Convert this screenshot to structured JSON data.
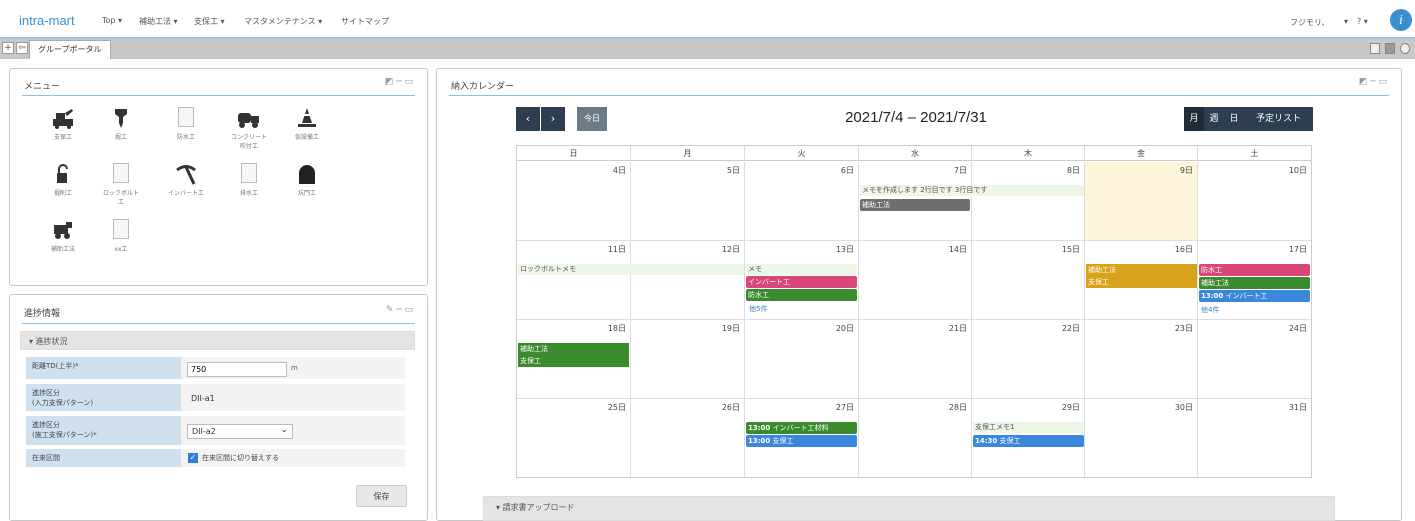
{
  "colors": {
    "accent": "#3a8fd0",
    "calendar_dark": "#2c3e50",
    "ev_green": "#3c8a2e",
    "ev_pink": "#d9467a",
    "ev_blue": "#3a87dc",
    "ev_gray": "#6f6f6f",
    "ev_gold": "#d9a21b",
    "today_bg": "#fcf5da",
    "line": "#8bbfe6"
  },
  "header": {
    "brand": "intra-mart",
    "nav": [
      "Top ▾",
      "補助工法 ▾",
      "支保工 ▾",
      "マスタメンテナンス ▾",
      "サイトマップ"
    ],
    "user": "フジモリ、",
    "user_caret": "▾",
    "help": "? ▾",
    "im_icon": "i"
  },
  "tabbar": {
    "add": "+",
    "toggle": "⇦",
    "tab": "グループポータル"
  },
  "menu": {
    "title": "メニュー",
    "tools": "◩ ─ ▭",
    "items": [
      {
        "label": "支保工",
        "icon": "excavator-icon"
      },
      {
        "label": "掘工",
        "icon": "drill-bit-icon"
      },
      {
        "label": "防水工",
        "icon": "document-icon"
      },
      {
        "label": "コンクリート\n吹付工",
        "icon": "concrete-truck-icon"
      },
      {
        "label": "仮設備工",
        "icon": "cone-icon"
      },
      {
        "label": "掘削工",
        "icon": "lock-icon"
      },
      {
        "label": "ロックボルト\n工",
        "icon": "document-icon"
      },
      {
        "label": "インバート工",
        "icon": "pickaxe-icon"
      },
      {
        "label": "排水工",
        "icon": "document-icon"
      },
      {
        "label": "坑門工",
        "icon": "tunnel-icon"
      },
      {
        "label": "補助工法",
        "icon": "machine-icon"
      },
      {
        "label": "xx工",
        "icon": "document-icon"
      }
    ]
  },
  "progress": {
    "title": "進捗情報",
    "tools": "✎ ─ ▭",
    "section": "▾ 進捗状況",
    "rows": [
      {
        "label": "距離TD(上半)*",
        "value": "750",
        "unit": "m"
      },
      {
        "label": "進捗区分\n(入力支保パターン)",
        "value": "DII-a1"
      },
      {
        "label": "進捗区分\n(施工支保パターン)*",
        "value": "DII-a2",
        "caret": "⌄"
      },
      {
        "label": "在来区間",
        "check_label": "在来区間に切り替えする"
      }
    ],
    "save": "保存"
  },
  "calendar": {
    "panel_title": "納入カレンダー",
    "tools": "◩ ─ ▭",
    "prev": "‹",
    "next": "›",
    "today": "今日",
    "title": "2021/7/4 – 2021/7/31",
    "views": [
      "月",
      "週",
      "日",
      "予定リスト"
    ],
    "day_headers": [
      "日",
      "月",
      "火",
      "水",
      "木",
      "金",
      "土"
    ],
    "weeks": [
      [
        "4日",
        "5日",
        "6日",
        "7日",
        "8日",
        "9日",
        "10日"
      ],
      [
        "11日",
        "12日",
        "13日",
        "14日",
        "15日",
        "16日",
        "17日"
      ],
      [
        "18日",
        "19日",
        "20日",
        "21日",
        "22日",
        "23日",
        "24日"
      ],
      [
        "25日",
        "26日",
        "27日",
        "28日",
        "29日",
        "30日",
        "31日"
      ]
    ],
    "events": {
      "w1_text": "メモを作成します 2行目です 3行目です",
      "w1_gray": "補助工法",
      "w2_text": "ロックボルトメモ",
      "w2_tue_text": "メモ",
      "w2_tue_pink": "インバート工",
      "w2_tue_green": "防水工",
      "w2_tue_more": "他5件",
      "w2_fri_a": "補助工法",
      "w2_fri_b": "支保工",
      "w2_sat_pink": "防水工",
      "w2_sat_green": "補助工法",
      "w2_sat_blue_time": "13:00",
      "w2_sat_blue": "インバート工",
      "w2_sat_more": "他4件",
      "w3_green_a": "補助工法",
      "w3_green_b": "支保工",
      "w4_tue_green_time": "13:00",
      "w4_tue_green": "インバート工材料",
      "w4_tue_blue_time": "13:00",
      "w4_tue_blue": "支保工",
      "w4_thu_text": "支保工メモ1",
      "w4_thu_blue_time": "14:30",
      "w4_thu_blue": "支保工"
    }
  },
  "upload": {
    "title": "▾ 請求書アップロード"
  }
}
